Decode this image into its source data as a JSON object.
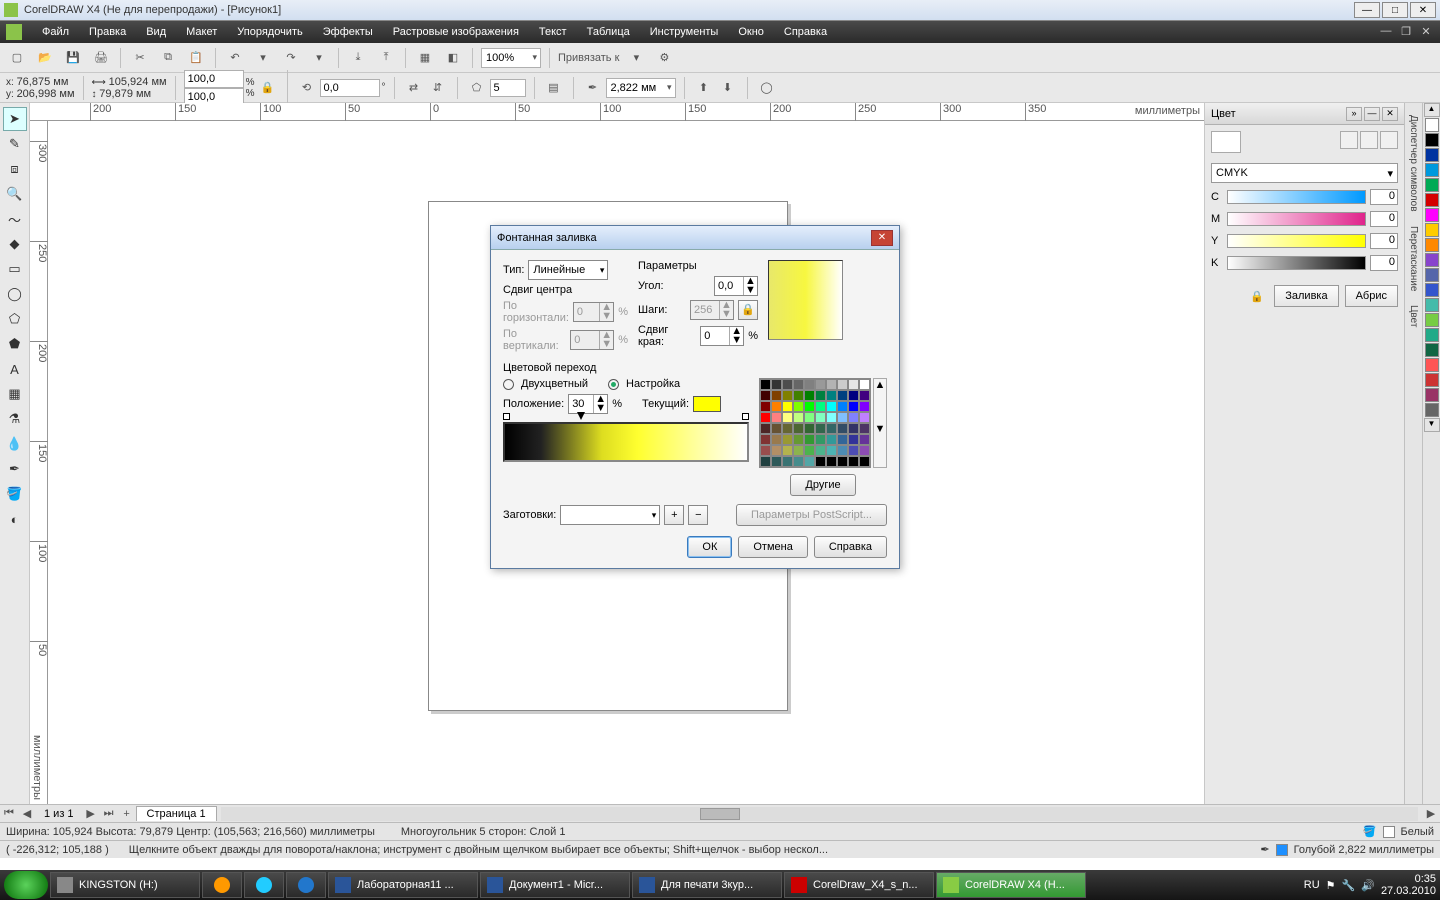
{
  "titlebar": {
    "text": "CorelDRAW X4 (Не для перепродажи) - [Рисунок1]"
  },
  "menu": [
    "Файл",
    "Правка",
    "Вид",
    "Макет",
    "Упорядочить",
    "Эффекты",
    "Растровые изображения",
    "Текст",
    "Таблица",
    "Инструменты",
    "Окно",
    "Справка"
  ],
  "toolbar1": {
    "zoom": "100%",
    "snap_label": "Привязать к"
  },
  "propbar": {
    "x": "76,875 мм",
    "y": "206,998 мм",
    "w": "105,924 мм",
    "h": "79,879 мм",
    "sx": "100,0",
    "sy": "100,0",
    "angle": "0,0",
    "sides": "5",
    "outline": "2,822 мм"
  },
  "ruler_unit": "миллиметры",
  "ruler_h": [
    "200",
    "150",
    "100",
    "50",
    "0",
    "50",
    "100",
    "150",
    "200",
    "250",
    "300",
    "350"
  ],
  "ruler_v": [
    "300",
    "250",
    "200",
    "150",
    "100",
    "50"
  ],
  "pagetabs": {
    "counter": "1 из 1",
    "tab": "Страница 1"
  },
  "status1": {
    "dims": "Ширина: 105,924 Высота: 79,879 Центр: (105,563; 216,560) миллиметры",
    "obj": "Многоугольник  5 сторон: Слой 1",
    "fill_label": "Белый",
    "stroke_label": "Голубой  2,822 миллиметры"
  },
  "status2": {
    "coords": "( -226,312; 105,188 )",
    "hint": "Щелкните объект дважды для поворота/наклона; инструмент с двойным щелчком выбирает все объекты; Shift+щелчок - выбор нескол..."
  },
  "color_panel": {
    "title": "Цвет",
    "model": "CMYK",
    "c": "0",
    "m": "0",
    "y": "0",
    "k": "0",
    "C_label": "C",
    "M_label": "M",
    "Y_label": "Y",
    "K_label": "K",
    "fill_btn": "Заливка",
    "outline_btn": "Абрис"
  },
  "side_tabs": [
    "Диспетчер символов",
    "Перетаскание",
    "Цвет"
  ],
  "dialog": {
    "title": "Фонтанная заливка",
    "type_label": "Тип:",
    "type_value": "Линейные",
    "center_label": "Сдвиг центра",
    "horiz_label": "По горизонтали:",
    "vert_label": "По вертикали:",
    "horiz_val": "0",
    "vert_val": "0",
    "params_label": "Параметры",
    "angle_label": "Угол:",
    "angle_val": "0,0",
    "steps_label": "Шаги:",
    "steps_val": "256",
    "edge_label": "Сдвиг края:",
    "edge_val": "0",
    "pct": "%",
    "blend_label": "Цветовой переход",
    "two_label": "Двухцветный",
    "custom_label": "Настройка",
    "pos_label": "Положение:",
    "pos_val": "30",
    "current_label": "Текущий:",
    "other_btn": "Другие",
    "presets_label": "Заготовки:",
    "ps_btn": "Параметры PostScript...",
    "ok": "ОК",
    "cancel": "Отмена",
    "help": "Справка"
  },
  "palette_colors": [
    "#ffffff",
    "#000000",
    "#0033a0",
    "#0099dd",
    "#00aa55",
    "#d40000",
    "#ff00ff",
    "#ffcc00",
    "#ff8800",
    "#8844cc",
    "#5566aa",
    "#3355cc",
    "#44bbaa",
    "#77cc44",
    "#22aa88",
    "#116644",
    "#ff5555",
    "#cc3333",
    "#993366",
    "#666666"
  ],
  "grid_colors": [
    "#000000",
    "#333333",
    "#4d4d4d",
    "#666666",
    "#808080",
    "#999999",
    "#b3b3b3",
    "#cccccc",
    "#e6e6e6",
    "#ffffff",
    "#400000",
    "#804000",
    "#808000",
    "#408000",
    "#008000",
    "#008040",
    "#008080",
    "#004080",
    "#000080",
    "#400080",
    "#800000",
    "#ff8000",
    "#ffff00",
    "#80ff00",
    "#00ff00",
    "#00ff80",
    "#00ffff",
    "#0080ff",
    "#0000ff",
    "#8000ff",
    "#ff0000",
    "#ff8080",
    "#ffff80",
    "#c0ff80",
    "#80ff80",
    "#80ffc0",
    "#80ffff",
    "#80c0ff",
    "#8080ff",
    "#c080ff",
    "#4d2626",
    "#665233",
    "#666633",
    "#4d6633",
    "#336633",
    "#33664d",
    "#336666",
    "#334d66",
    "#333366",
    "#4d3366",
    "#803333",
    "#997a4d",
    "#999933",
    "#669933",
    "#339933",
    "#339966",
    "#339999",
    "#336699",
    "#333399",
    "#663399",
    "#994d4d",
    "#b38f66",
    "#b3b34d",
    "#8cb34d",
    "#4db34d",
    "#4db38c",
    "#4db3b3",
    "#4d8cb3",
    "#4d4db3",
    "#8c4db3",
    "#204040",
    "#2d5959",
    "#397373",
    "#468c8c",
    "#53a6a6",
    "#000000",
    "#000000",
    "#000000",
    "#000000",
    "#000000"
  ],
  "taskbar": {
    "items": [
      "KINGSTON (H:)",
      "",
      "",
      "",
      "Лабораторная11 ...",
      "Документ1 - Micr...",
      "Для печати 3кур...",
      "CorelDraw_X4_s_n...",
      "CorelDRAW X4 (Н..."
    ],
    "lang": "RU",
    "time": "0:35",
    "date": "27.03.2010"
  }
}
